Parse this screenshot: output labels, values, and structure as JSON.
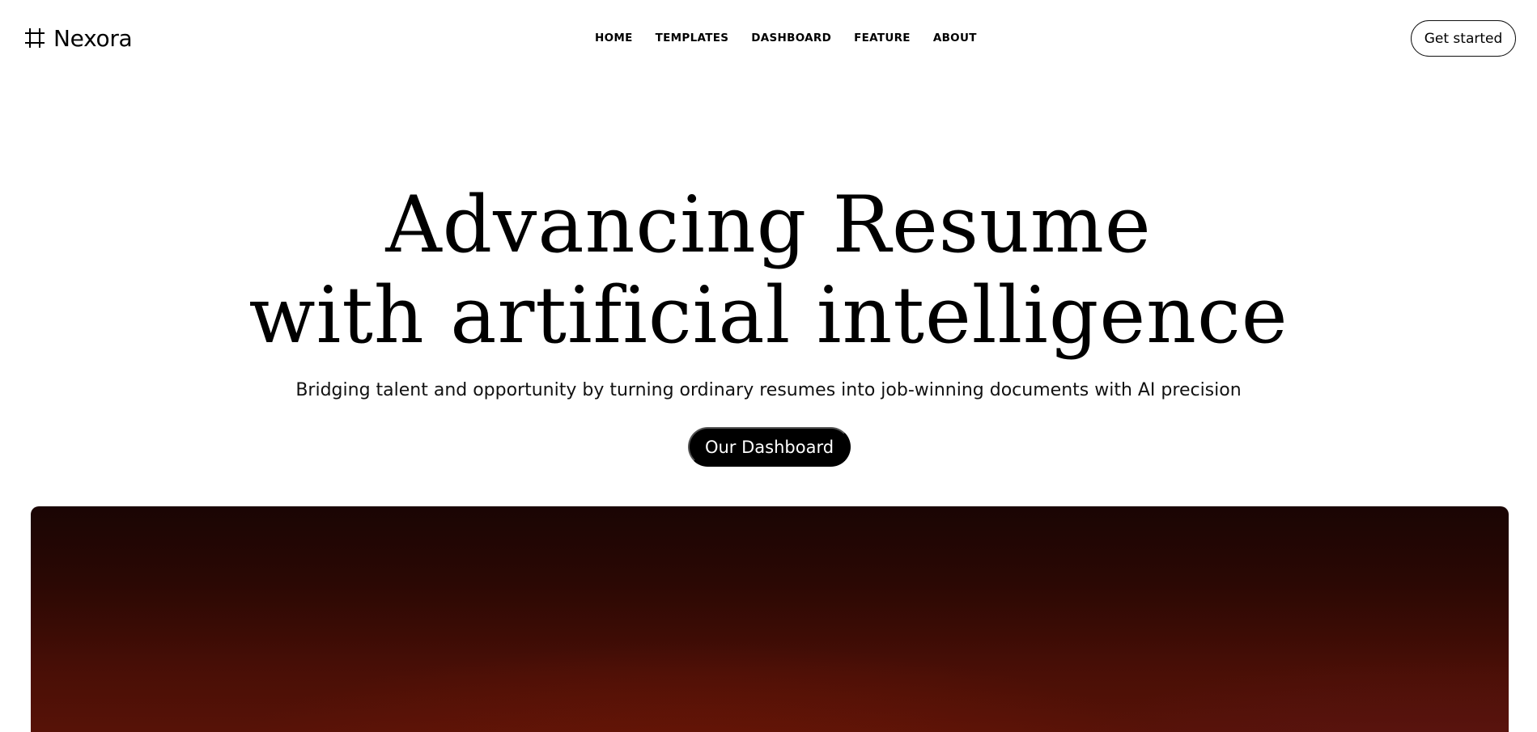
{
  "brand": {
    "name": "Nexora",
    "icon": "grid-hash-icon"
  },
  "nav": {
    "items": [
      {
        "label": "HOME"
      },
      {
        "label": "TEMPLATES"
      },
      {
        "label": "DASHBOARD"
      },
      {
        "label": "FEATURE"
      },
      {
        "label": "ABOUT"
      }
    ]
  },
  "header": {
    "cta_label": "Get started"
  },
  "hero": {
    "title_line1": "Advancing Resume",
    "title_line2": "with artificial intelligence",
    "subtitle": "Bridging talent and opportunity by turning ordinary resumes into job-winning documents with AI precision",
    "cta_label": "Our Dashboard"
  },
  "colors": {
    "text": "#000000",
    "background": "#ffffff",
    "button_dark": "#000000",
    "showcase_top": "#1a0504",
    "showcase_bottom": "#5e1408"
  }
}
